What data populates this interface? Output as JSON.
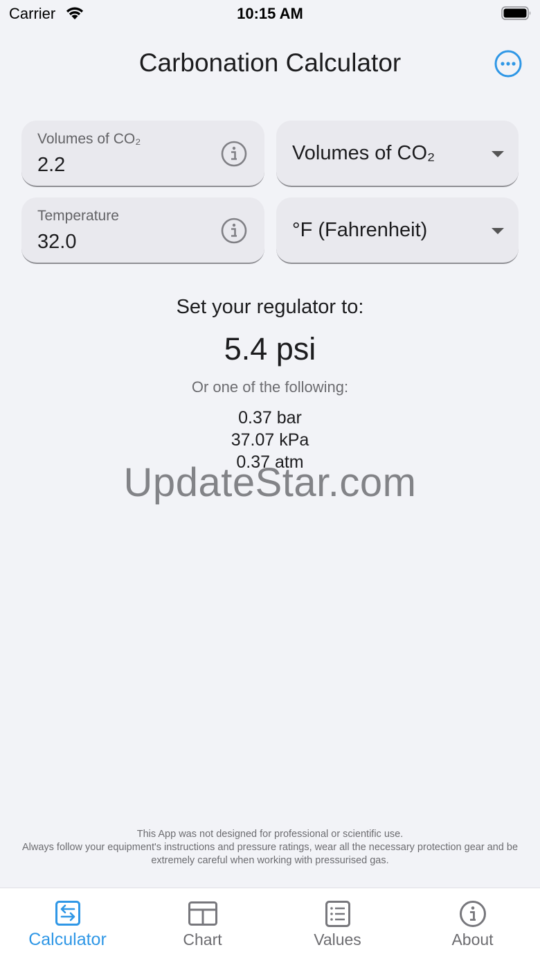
{
  "status_bar": {
    "carrier": "Carrier",
    "time": "10:15 AM",
    "wifi_icon": "wifi-icon",
    "battery_icon": "battery-full-icon"
  },
  "header": {
    "title": "Carbonation Calculator",
    "more_icon": "ellipsis-circle-icon"
  },
  "inputs": {
    "volumes": {
      "label": "Volumes of CO₂",
      "value": "2.2",
      "info_icon": "info-circle-icon"
    },
    "volumes_unit": {
      "selected": "Volumes of CO₂"
    },
    "temperature": {
      "label": "Temperature",
      "value": "32.0",
      "info_icon": "info-circle-icon"
    },
    "temperature_unit": {
      "selected": "°F (Fahrenheit)"
    }
  },
  "result": {
    "heading": "Set your regulator to:",
    "primary": "5.4 psi",
    "subheading": "Or one of the following:",
    "alternatives": [
      "0.37 bar",
      "37.07 kPa",
      "0.37 atm"
    ]
  },
  "watermark": "UpdateStar.com",
  "disclaimer": {
    "line1": "This App was not designed for professional or scientific use.",
    "line2": "Always follow your equipment's instructions and pressure ratings, wear all the necessary protection gear and be extremely careful when working with pressurised gas."
  },
  "tabs": [
    {
      "label": "Calculator",
      "icon": "calculator-swap-icon",
      "active": true
    },
    {
      "label": "Chart",
      "icon": "chart-table-icon",
      "active": false
    },
    {
      "label": "Values",
      "icon": "list-values-icon",
      "active": false
    },
    {
      "label": "About",
      "icon": "info-circle-icon",
      "active": false
    }
  ],
  "colors": {
    "accent": "#2f97e6",
    "background": "#f2f3f7",
    "field": "#e9e9ee"
  }
}
